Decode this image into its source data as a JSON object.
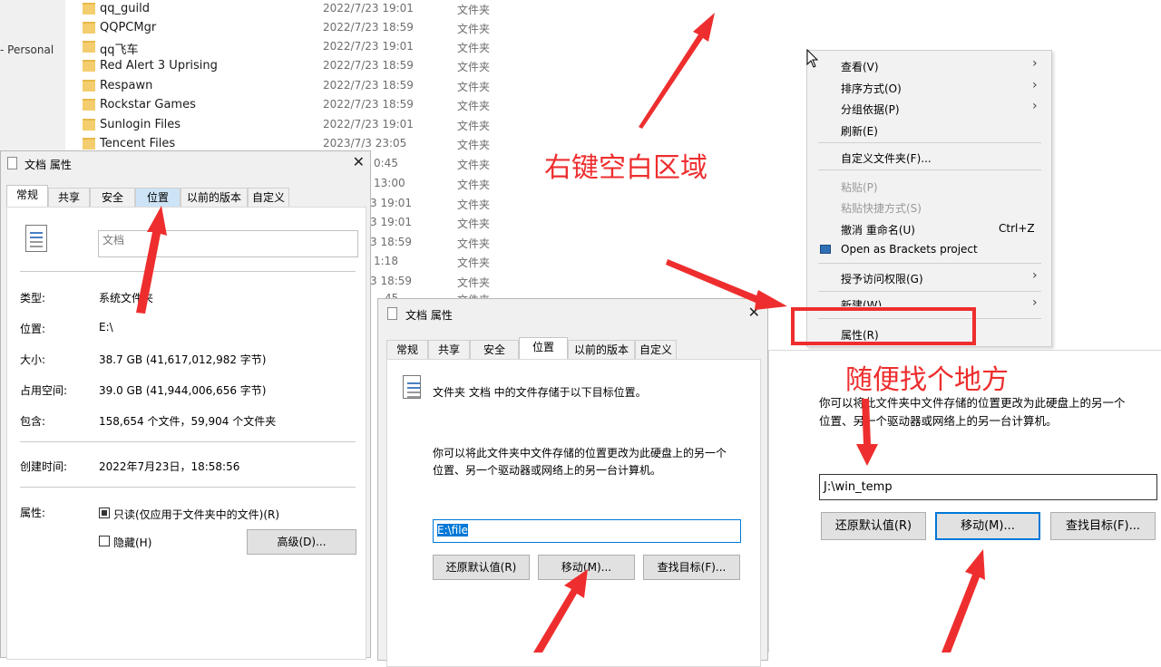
{
  "explorer": {
    "nav_label": "- Personal",
    "rows": [
      {
        "name": "qq_guild",
        "date": "2022/7/23 19:01",
        "type": "文件夹"
      },
      {
        "name": "QQPCMgr",
        "date": "2022/7/23 18:59",
        "type": "文件夹"
      },
      {
        "name": "qq飞车",
        "date": "2022/7/23 19:01",
        "type": "文件夹"
      },
      {
        "name": "Red Alert 3 Uprising",
        "date": "2022/7/23 18:59",
        "type": "文件夹"
      },
      {
        "name": "Respawn",
        "date": "2022/7/23 18:59",
        "type": "文件夹"
      },
      {
        "name": "Rockstar Games",
        "date": "2022/7/23 18:59",
        "type": "文件夹"
      },
      {
        "name": "Sunlogin Files",
        "date": "2022/7/23 19:01",
        "type": "文件夹"
      },
      {
        "name": "Tencent Files",
        "date": "2023/7/3 23:05",
        "type": "文件夹"
      }
    ],
    "partial_dates": [
      "0:45",
      "13:00",
      "3 19:01",
      "3 19:01",
      "3 18:59",
      "1:18",
      "3 18:59",
      "45"
    ],
    "partial_type": "文件夹"
  },
  "dialog1": {
    "title": "文档 属性",
    "tabs": [
      "常规",
      "共享",
      "安全",
      "位置",
      "以前的版本",
      "自定义"
    ],
    "name_value": "文档",
    "props": [
      {
        "label": "类型:",
        "value": "系统文件夹"
      },
      {
        "label": "位置:",
        "value": "E:\\"
      },
      {
        "label": "大小:",
        "value": "38.7 GB (41,617,012,982 字节)"
      },
      {
        "label": "占用空间:",
        "value": "39.0 GB (41,944,006,656 字节)"
      },
      {
        "label": "包含:",
        "value": "158,654 个文件，59,904 个文件夹"
      }
    ],
    "created_label": "创建时间:",
    "created_value": "2022年7月23日，18:58:56",
    "attr_label": "属性:",
    "readonly_label": "只读(仅应用于文件夹中的文件)(R)",
    "hidden_label": "隐藏(H)",
    "advanced_button": "高级(D)..."
  },
  "dialog2": {
    "title": "文档 属性",
    "tabs": [
      "常规",
      "共享",
      "安全",
      "位置",
      "以前的版本",
      "自定义"
    ],
    "intro": "文件夹 文档 中的文件存储于以下目标位置。",
    "desc_line1": "你可以将此文件夹中文件存储的位置更改为此硬盘上的另一个",
    "desc_line2": "位置、另一个驱动器或网络上的另一台计算机。",
    "path_value": "E:\\file",
    "restore_button": "还原默认值(R)",
    "move_button": "移动(M)...",
    "find_button": "查找目标(F)..."
  },
  "context_menu": {
    "items": [
      {
        "label": "查看(V)",
        "arrow": "›"
      },
      {
        "label": "排序方式(O)",
        "arrow": "›"
      },
      {
        "label": "分组依据(P)",
        "arrow": "›"
      },
      {
        "label": "刷新(E)"
      },
      {
        "label": "自定义文件夹(F)..."
      },
      {
        "label": "粘贴(P)"
      },
      {
        "label": "粘贴快捷方式(S)"
      },
      {
        "label": "撤消 重命名(U)",
        "shortcut": "Ctrl+Z"
      },
      {
        "label": "Open as Brackets project"
      },
      {
        "label": "授予访问权限(G)",
        "arrow": "›"
      },
      {
        "label": "新建(W)",
        "arrow": "›"
      },
      {
        "label": "属性(R)"
      }
    ]
  },
  "panel3": {
    "desc_line1": "你可以将此文件夹中文件存储的位置更改为此硬盘上的另一个",
    "desc_line2": "位置、另一个驱动器或网络上的另一台计算机。",
    "path_value": "J:\\win_temp",
    "restore_button": "还原默认值(R)",
    "move_button": "移动(M)...",
    "find_button": "查找目标(F)..."
  },
  "annotations": {
    "right_click_text": "右键空白区域",
    "anywhere_text": "随便找个地方",
    "color": "#ee2e2e"
  }
}
